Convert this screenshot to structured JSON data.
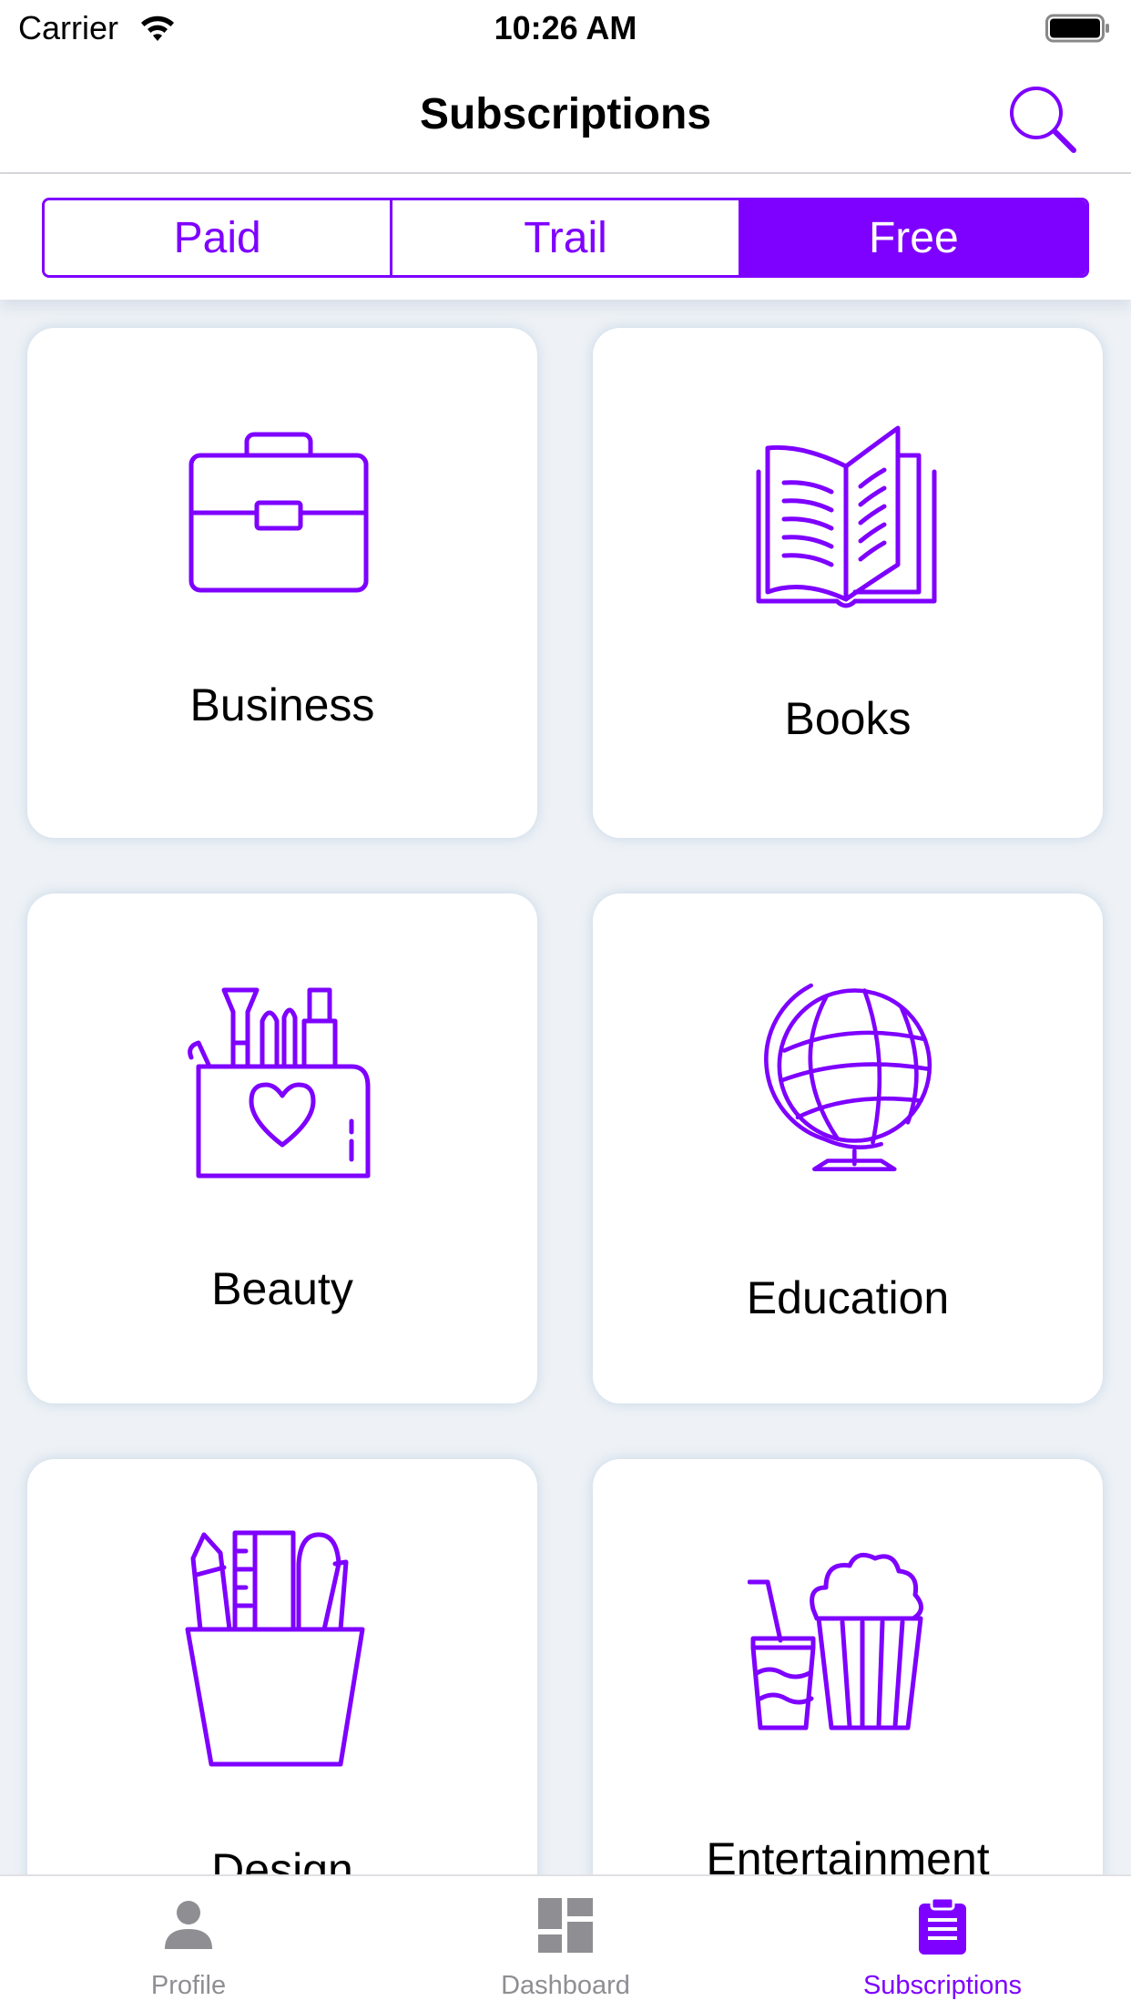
{
  "status_bar": {
    "carrier": "Carrier",
    "time": "10:26 AM"
  },
  "nav": {
    "title": "Subscriptions",
    "search_icon": "search-icon"
  },
  "segments": [
    {
      "label": "Paid",
      "active": false
    },
    {
      "label": "Trail",
      "active": false
    },
    {
      "label": "Free",
      "active": true
    }
  ],
  "categories": [
    {
      "label": "Business",
      "icon": "briefcase-icon"
    },
    {
      "label": "Books",
      "icon": "open-book-icon"
    },
    {
      "label": "Beauty",
      "icon": "makeup-bag-icon"
    },
    {
      "label": "Education",
      "icon": "globe-icon"
    },
    {
      "label": "Design",
      "icon": "pencil-cup-icon"
    },
    {
      "label": "Entertainment",
      "icon": "popcorn-drink-icon"
    }
  ],
  "tabs": [
    {
      "label": "Profile",
      "icon": "person-icon",
      "active": false
    },
    {
      "label": "Dashboard",
      "icon": "dashboard-icon",
      "active": false
    },
    {
      "label": "Subscriptions",
      "icon": "clipboard-icon",
      "active": true
    }
  ],
  "colors": {
    "accent": "#7e00ff",
    "inactive": "#8e8e93",
    "background": "#eef2f6"
  }
}
